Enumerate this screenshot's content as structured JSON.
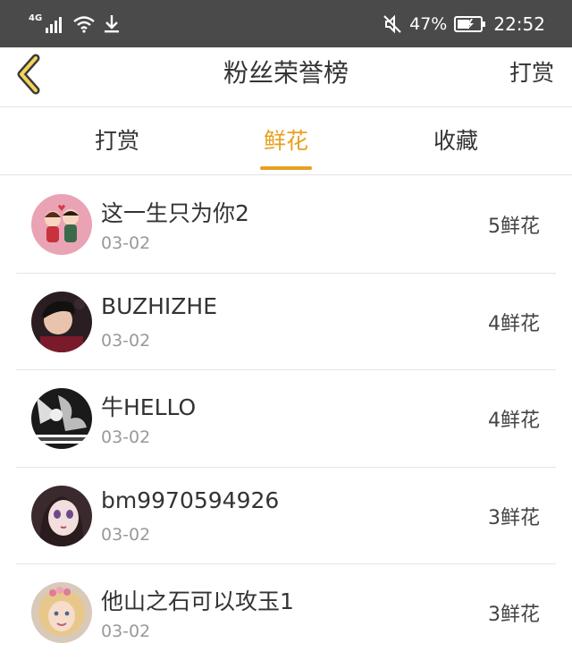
{
  "status_bar": {
    "network": "4G",
    "battery_percent": "47%",
    "time": "22:52"
  },
  "header": {
    "title": "粉丝荣誉榜",
    "action": "打赏"
  },
  "tabs": [
    {
      "label": "打赏",
      "active": false
    },
    {
      "label": "鲜花",
      "active": true
    },
    {
      "label": "收藏",
      "active": false
    }
  ],
  "colors": {
    "accent": "#e8a020",
    "status_bar_bg": "#4a4a4a",
    "divider": "#e4e4e4"
  },
  "list": [
    {
      "name": "这一生只为你2",
      "date": "03-02",
      "count": "5鲜花",
      "avatar": "cartoon-couple-avatar"
    },
    {
      "name": "BUZHIZHE",
      "date": "03-02",
      "count": "4鲜花",
      "avatar": "young-man-avatar"
    },
    {
      "name": "牛HELLO",
      "date": "03-02",
      "count": "4鲜花",
      "avatar": "black-white-avatar"
    },
    {
      "name": "bm9970594926",
      "date": "03-02",
      "count": "3鲜花",
      "avatar": "anime-girl-avatar"
    },
    {
      "name": "他山之石可以攻玉1",
      "date": "03-02",
      "count": "3鲜花",
      "avatar": "child-avatar"
    }
  ]
}
